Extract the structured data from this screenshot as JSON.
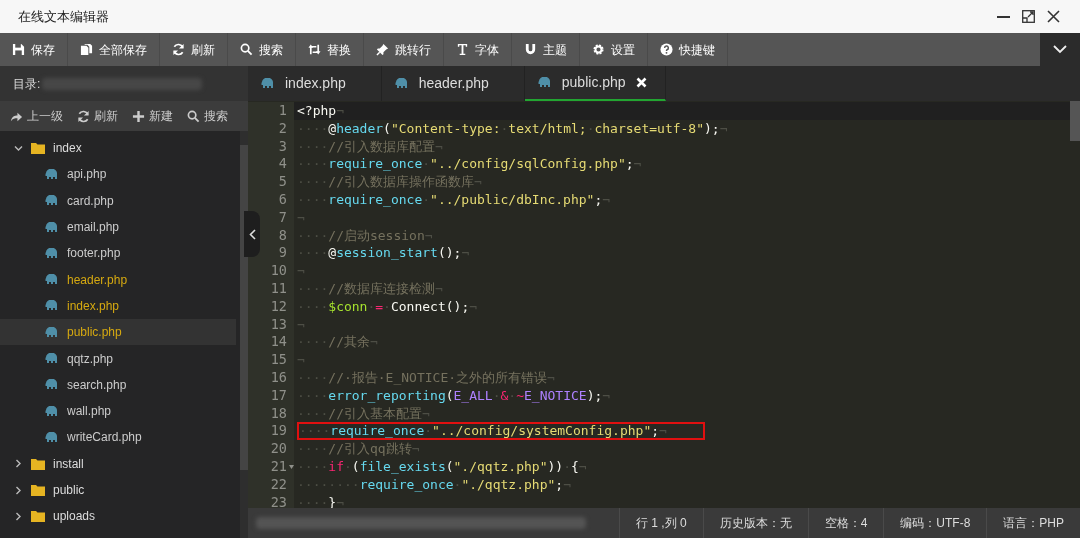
{
  "window": {
    "title": "在线文本编辑器"
  },
  "toolbar": [
    {
      "label": "保存"
    },
    {
      "label": "全部保存"
    },
    {
      "label": "刷新"
    },
    {
      "label": "搜索"
    },
    {
      "label": "替换"
    },
    {
      "label": "跳转行"
    },
    {
      "label": "字体"
    },
    {
      "label": "主题"
    },
    {
      "label": "设置"
    },
    {
      "label": "快捷键"
    }
  ],
  "sidebar": {
    "directory_label": "目录:",
    "actions": [
      {
        "label": "上一级"
      },
      {
        "label": "刷新"
      },
      {
        "label": "新建"
      },
      {
        "label": "搜索"
      }
    ],
    "tree": [
      {
        "kind": "folder",
        "label": "index",
        "expanded": true,
        "children": [
          {
            "kind": "file",
            "label": "api.php",
            "open": false,
            "selected": false
          },
          {
            "kind": "file",
            "label": "card.php",
            "open": false,
            "selected": false
          },
          {
            "kind": "file",
            "label": "email.php",
            "open": false,
            "selected": false
          },
          {
            "kind": "file",
            "label": "footer.php",
            "open": false,
            "selected": false
          },
          {
            "kind": "file",
            "label": "header.php",
            "open": true,
            "selected": false
          },
          {
            "kind": "file",
            "label": "index.php",
            "open": true,
            "selected": false
          },
          {
            "kind": "file",
            "label": "public.php",
            "open": true,
            "selected": true
          },
          {
            "kind": "file",
            "label": "qqtz.php",
            "open": false,
            "selected": false
          },
          {
            "kind": "file",
            "label": "search.php",
            "open": false,
            "selected": false
          },
          {
            "kind": "file",
            "label": "wall.php",
            "open": false,
            "selected": false
          },
          {
            "kind": "file",
            "label": "writeCard.php",
            "open": false,
            "selected": false
          }
        ]
      },
      {
        "kind": "folder",
        "label": "install",
        "expanded": false
      },
      {
        "kind": "folder",
        "label": "public",
        "expanded": false
      },
      {
        "kind": "folder",
        "label": "uploads",
        "expanded": false
      }
    ]
  },
  "tabs": [
    {
      "label": "index.php",
      "selected": false
    },
    {
      "label": "header.php",
      "selected": false
    },
    {
      "label": "public.php",
      "selected": true
    }
  ],
  "editor": {
    "lines": [
      {
        "number": "1",
        "tokens": [
          {
            "kind": "plain",
            "t": "<?php"
          },
          {
            "kind": "ws",
            "t": "¬"
          }
        ]
      },
      {
        "number": "2",
        "tokens": [
          {
            "kind": "ws",
            "t": "····"
          },
          {
            "kind": "plain",
            "t": "@"
          },
          {
            "kind": "fn",
            "t": "header"
          },
          {
            "kind": "plain",
            "t": "("
          },
          {
            "kind": "str",
            "t": "\"Content-type:"
          },
          {
            "kind": "ws",
            "t": "·"
          },
          {
            "kind": "str",
            "t": "text/html;"
          },
          {
            "kind": "ws",
            "t": "·"
          },
          {
            "kind": "str",
            "t": "charset=utf-8\""
          },
          {
            "kind": "plain",
            "t": ");"
          },
          {
            "kind": "ws",
            "t": "¬"
          }
        ]
      },
      {
        "number": "3",
        "tokens": [
          {
            "kind": "ws",
            "t": "····"
          },
          {
            "kind": "comment",
            "t": "//引入数据库配置"
          },
          {
            "kind": "ws",
            "t": "¬"
          }
        ]
      },
      {
        "number": "4",
        "tokens": [
          {
            "kind": "ws",
            "t": "····"
          },
          {
            "kind": "fn",
            "t": "require_once"
          },
          {
            "kind": "ws",
            "t": "·"
          },
          {
            "kind": "str",
            "t": "\"../config/sqlConfig.php\""
          },
          {
            "kind": "plain",
            "t": ";"
          },
          {
            "kind": "ws",
            "t": "¬"
          }
        ]
      },
      {
        "number": "5",
        "tokens": [
          {
            "kind": "ws",
            "t": "····"
          },
          {
            "kind": "comment",
            "t": "//引入数据库操作函数库"
          },
          {
            "kind": "ws",
            "t": "¬"
          }
        ]
      },
      {
        "number": "6",
        "tokens": [
          {
            "kind": "ws",
            "t": "····"
          },
          {
            "kind": "fn",
            "t": "require_once"
          },
          {
            "kind": "ws",
            "t": "·"
          },
          {
            "kind": "str",
            "t": "\"../public/dbInc.php\""
          },
          {
            "kind": "plain",
            "t": ";"
          },
          {
            "kind": "ws",
            "t": "¬"
          }
        ]
      },
      {
        "number": "7",
        "tokens": [
          {
            "kind": "ws",
            "t": "¬"
          }
        ]
      },
      {
        "number": "8",
        "tokens": [
          {
            "kind": "ws",
            "t": "····"
          },
          {
            "kind": "comment",
            "t": "//启动session"
          },
          {
            "kind": "ws",
            "t": "¬"
          }
        ]
      },
      {
        "number": "9",
        "tokens": [
          {
            "kind": "ws",
            "t": "····"
          },
          {
            "kind": "plain",
            "t": "@"
          },
          {
            "kind": "fn",
            "t": "session_start"
          },
          {
            "kind": "plain",
            "t": "();"
          },
          {
            "kind": "ws",
            "t": "¬"
          }
        ]
      },
      {
        "number": "10",
        "tokens": [
          {
            "kind": "ws",
            "t": "¬"
          }
        ]
      },
      {
        "number": "11",
        "tokens": [
          {
            "kind": "ws",
            "t": "····"
          },
          {
            "kind": "comment",
            "t": "//数据库连接检测"
          },
          {
            "kind": "ws",
            "t": "¬"
          }
        ]
      },
      {
        "number": "12",
        "tokens": [
          {
            "kind": "ws",
            "t": "····"
          },
          {
            "kind": "var",
            "t": "$conn"
          },
          {
            "kind": "ws",
            "t": "·"
          },
          {
            "kind": "op",
            "t": "="
          },
          {
            "kind": "ws",
            "t": "·"
          },
          {
            "kind": "plain",
            "t": "Connect();"
          },
          {
            "kind": "ws",
            "t": "¬"
          }
        ]
      },
      {
        "number": "13",
        "tokens": [
          {
            "kind": "ws",
            "t": "¬"
          }
        ]
      },
      {
        "number": "14",
        "tokens": [
          {
            "kind": "ws",
            "t": "····"
          },
          {
            "kind": "comment",
            "t": "//其余"
          },
          {
            "kind": "ws",
            "t": "¬"
          }
        ]
      },
      {
        "number": "15",
        "tokens": [
          {
            "kind": "ws",
            "t": "¬"
          }
        ]
      },
      {
        "number": "16",
        "tokens": [
          {
            "kind": "ws",
            "t": "····"
          },
          {
            "kind": "comment",
            "t": "//·报告·E_NOTICE·之外的所有错误"
          },
          {
            "kind": "ws",
            "t": "¬"
          }
        ]
      },
      {
        "number": "17",
        "tokens": [
          {
            "kind": "ws",
            "t": "····"
          },
          {
            "kind": "fn",
            "t": "error_reporting"
          },
          {
            "kind": "plain",
            "t": "("
          },
          {
            "kind": "const",
            "t": "E_ALL"
          },
          {
            "kind": "ws",
            "t": "·"
          },
          {
            "kind": "op",
            "t": "&"
          },
          {
            "kind": "ws",
            "t": "·"
          },
          {
            "kind": "op",
            "t": "~"
          },
          {
            "kind": "const",
            "t": "E_NOTICE"
          },
          {
            "kind": "plain",
            "t": ");"
          },
          {
            "kind": "ws",
            "t": "¬"
          }
        ]
      },
      {
        "number": "18",
        "tokens": [
          {
            "kind": "ws",
            "t": "····"
          },
          {
            "kind": "comment",
            "t": "//引入基本配置"
          },
          {
            "kind": "ws",
            "t": "¬"
          }
        ]
      },
      {
        "number": "19",
        "annotated": true,
        "tokens": [
          {
            "kind": "ws",
            "t": "····"
          },
          {
            "kind": "fn",
            "t": "require_once"
          },
          {
            "kind": "ws",
            "t": "·"
          },
          {
            "kind": "str",
            "t": "\"../config/systemConfig.php\""
          },
          {
            "kind": "plain",
            "t": ";"
          },
          {
            "kind": "ws",
            "t": "¬"
          }
        ]
      },
      {
        "number": "20",
        "tokens": [
          {
            "kind": "ws",
            "t": "····"
          },
          {
            "kind": "comment",
            "t": "//引入qq跳转"
          },
          {
            "kind": "ws",
            "t": "¬"
          }
        ]
      },
      {
        "number": "21",
        "foldable": true,
        "tokens": [
          {
            "kind": "ws",
            "t": "····"
          },
          {
            "kind": "kw",
            "t": "if"
          },
          {
            "kind": "ws",
            "t": "·"
          },
          {
            "kind": "plain",
            "t": "("
          },
          {
            "kind": "fn",
            "t": "file_exists"
          },
          {
            "kind": "plain",
            "t": "("
          },
          {
            "kind": "str",
            "t": "\"./qqtz.php\""
          },
          {
            "kind": "plain",
            "t": "))"
          },
          {
            "kind": "ws",
            "t": "·"
          },
          {
            "kind": "plain",
            "t": "{"
          },
          {
            "kind": "ws",
            "t": "¬"
          }
        ]
      },
      {
        "number": "22",
        "tokens": [
          {
            "kind": "ws",
            "t": "········"
          },
          {
            "kind": "fn",
            "t": "require_once"
          },
          {
            "kind": "ws",
            "t": "·"
          },
          {
            "kind": "str",
            "t": "\"./qqtz.php\""
          },
          {
            "kind": "plain",
            "t": ";"
          },
          {
            "kind": "ws",
            "t": "¬"
          }
        ]
      },
      {
        "number": "23",
        "tokens": [
          {
            "kind": "ws",
            "t": "····"
          },
          {
            "kind": "plain",
            "t": "}"
          },
          {
            "kind": "ws",
            "t": "¬"
          }
        ]
      }
    ]
  },
  "status_bar": [
    "行 1 ,列 0",
    "历史版本：无",
    "空格：4",
    "编码：UTF-8",
    "语言：PHP"
  ]
}
